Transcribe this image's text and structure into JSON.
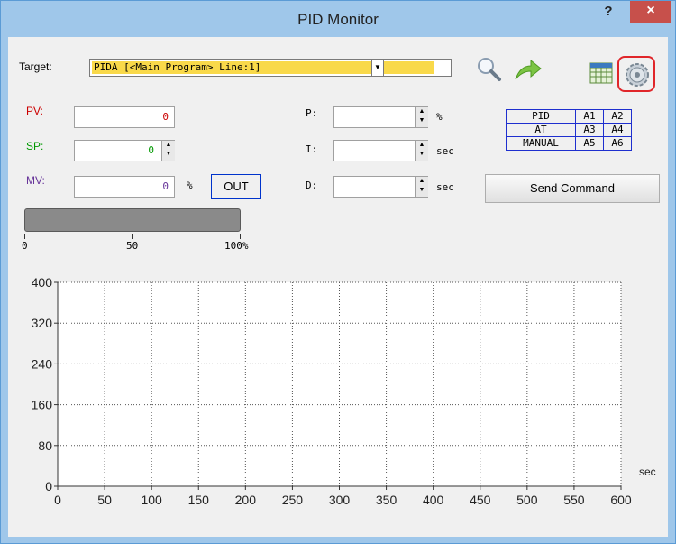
{
  "window": {
    "title": "PID Monitor",
    "help_label": "?",
    "close_label": "×"
  },
  "target": {
    "label": "Target:",
    "value": "PIDA [<Main Program> Line:1]"
  },
  "fields": {
    "pv": {
      "label": "PV:",
      "value": "0",
      "color": "#cc0000"
    },
    "sp": {
      "label": "SP:",
      "value": "0",
      "color": "#009900"
    },
    "mv": {
      "label": "MV:",
      "value": "0",
      "unit": "%",
      "color": "#663399"
    }
  },
  "params": {
    "p": {
      "label": "P:",
      "value": "",
      "unit": "%"
    },
    "i": {
      "label": "I:",
      "value": "",
      "unit": "sec"
    },
    "d": {
      "label": "D:",
      "value": "",
      "unit": "sec"
    }
  },
  "out_button": "OUT",
  "send_button": "Send Command",
  "mode_table": [
    [
      "PID",
      "A1",
      "A2"
    ],
    [
      "AT",
      "A3",
      "A4"
    ],
    [
      "MANUAL",
      "A5",
      "A6"
    ]
  ],
  "output_bar": {
    "value": 0,
    "scale": [
      "0",
      "50",
      "100%"
    ]
  },
  "chart_data": {
    "type": "line",
    "x_ticks": [
      "0",
      "50",
      "100",
      "150",
      "200",
      "250",
      "300",
      "350",
      "400",
      "450",
      "500",
      "550",
      "600"
    ],
    "y_ticks": [
      "0",
      "80",
      "160",
      "240",
      "320",
      "400"
    ],
    "xlim": [
      0,
      600
    ],
    "ylim": [
      0,
      400
    ],
    "xlabel": "sec",
    "ylabel": "",
    "grid": true,
    "series": []
  }
}
